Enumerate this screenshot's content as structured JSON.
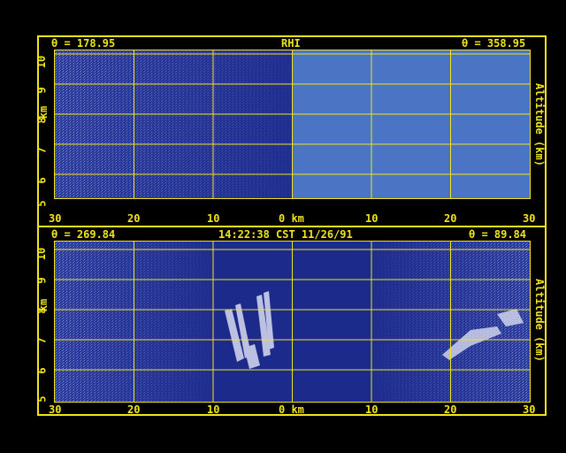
{
  "top_panel": {
    "left_angle": "θ = 178.95",
    "title": "RHI",
    "right_angle": "θ = 358.95",
    "y_ticks": [
      "5",
      "6",
      "7",
      "8",
      "9",
      "10"
    ],
    "y_label_left": "km",
    "y_label_right": "Altitude (km)",
    "x_ticks": [
      "30",
      "20",
      "10",
      "0 km",
      "10",
      "20",
      "30"
    ]
  },
  "bottom_panel": {
    "left_angle": "θ = 269.84",
    "timestamp": "14:22:38 CST 11/26/91",
    "right_angle": "θ = 89.84",
    "y_ticks": [
      "5",
      "6",
      "7",
      "8",
      "9",
      "10"
    ],
    "y_label_left": "km",
    "y_label_right": "Altitude (km)",
    "x_ticks": [
      "30",
      "20",
      "10",
      "0 km",
      "10",
      "20",
      "30"
    ]
  },
  "colors": {
    "frame": "#f2e41a",
    "background": "#1c2a8c",
    "fill_block": "#4c74c4",
    "echo": "#d8dcf0"
  }
}
